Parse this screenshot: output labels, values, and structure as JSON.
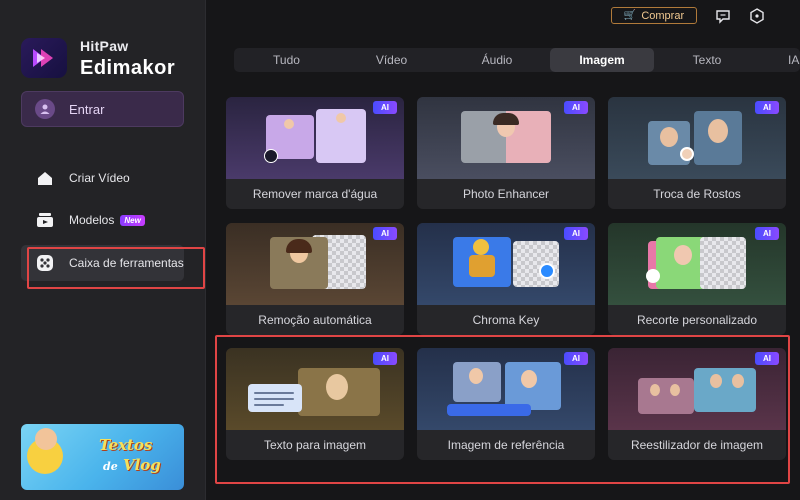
{
  "app": {
    "brand_top": "HitPaw",
    "brand_main": "Edimakor"
  },
  "sidebar": {
    "login_label": "Entrar",
    "items": [
      {
        "label": "Criar Vídeo",
        "icon": "home-icon"
      },
      {
        "label": "Modelos",
        "icon": "template-icon",
        "badge": "New"
      },
      {
        "label": "Caixa de ferramentas",
        "icon": "toolbox-icon"
      }
    ],
    "promo": {
      "line1": "Textos",
      "line2_prefix": "de",
      "line2": "Vlog"
    }
  },
  "topbar": {
    "buy_label": "Comprar",
    "icons": [
      "feedback-icon",
      "settings-icon"
    ]
  },
  "tabs": [
    {
      "label": "Tudo"
    },
    {
      "label": "Vídeo"
    },
    {
      "label": "Áudio"
    },
    {
      "label": "Imagem",
      "active": true
    },
    {
      "label": "Texto"
    },
    {
      "label": "IA"
    }
  ],
  "ai_badge": "AI",
  "cards": [
    {
      "label": "Remover marca d'água",
      "ai": true
    },
    {
      "label": "Photo Enhancer",
      "ai": true
    },
    {
      "label": "Troca de Rostos",
      "ai": true
    },
    {
      "label": "Remoção automática",
      "ai": true
    },
    {
      "label": "Chroma Key",
      "ai": true
    },
    {
      "label": "Recorte personalizado",
      "ai": true
    },
    {
      "label": "Texto para imagem",
      "ai": true
    },
    {
      "label": "Imagem de referência",
      "ai": true
    },
    {
      "label": "Reestilizador de imagem",
      "ai": true
    }
  ],
  "colors": {
    "accent_purple": "#8a4aff",
    "highlight_red": "#e04545",
    "buy_gold": "#b07a3a"
  }
}
